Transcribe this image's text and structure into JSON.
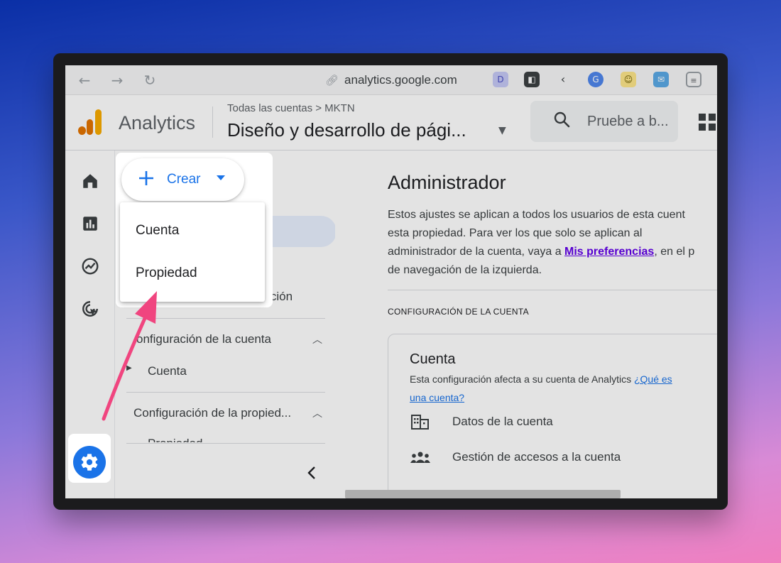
{
  "browser": {
    "url": "analytics.google.com"
  },
  "header": {
    "app_name": "Analytics",
    "breadcrumb": "Todas las cuentas > MKTN",
    "property_title": "Diseño y desarrollo de pági...",
    "search_placeholder": "Pruebe a b..."
  },
  "sidebar": {
    "partial_item": "gación",
    "account_section": "onfiguración de la cuenta",
    "account_item": "Cuenta",
    "property_section": "Configuración de la propied...",
    "property_item_partial": "Propiedad"
  },
  "create_menu": {
    "button_label": "Crear",
    "items": [
      "Cuenta",
      "Propiedad"
    ]
  },
  "main": {
    "title": "Administrador",
    "desc_line1": "Estos ajustes se aplican a todos los usuarios de esta cuent",
    "desc_line2": "esta propiedad. Para ver los que solo se aplican al",
    "desc_line3_pre": "administrador de la cuenta, vaya a ",
    "desc_link": "Mis preferencias",
    "desc_line3_post": ", en el p",
    "desc_line4": "de navegación de la izquierda.",
    "section_label": "CONFIGURACIÓN DE LA CUENTA",
    "card": {
      "title": "Cuenta",
      "desc_text": "Esta configuración afecta a su cuenta de Analytics ",
      "desc_link_1": "¿Qué es",
      "desc_link_2": "una cuenta?",
      "rows": [
        "Datos de la cuenta",
        "Gestión de accesos a la cuenta"
      ]
    }
  },
  "colors": {
    "accent": "#1a73e8",
    "link_visited": "#6200ea",
    "arrow": "#f0457f",
    "logo_orange": "#f9ab00",
    "logo_dark_orange": "#e37400"
  }
}
